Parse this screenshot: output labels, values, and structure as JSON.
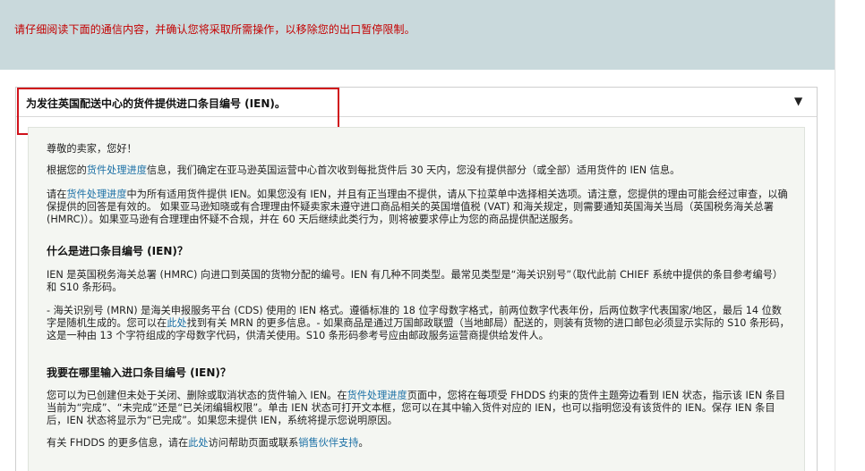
{
  "banner": {
    "text": "请仔细阅读下面的通信内容，并确认您将采取所需操作，以移除您的出口暂停限制。"
  },
  "accordion": {
    "title": "为发往英国配送中心的货件提供进口条目编号 (IEN)。",
    "arrow": "▼"
  },
  "content": {
    "greeting": "尊敬的卖家，您好！",
    "p1_before": "根据您的",
    "p1_link": "货件处理进度",
    "p1_after": "信息，我们确定在亚马逊英国运营中心首次收到每批货件后 30 天内，您没有提供部分（或全部）适用货件的 IEN 信息。",
    "p2_before": "请在",
    "p2_link": "货件处理进度",
    "p2_after": "中为所有适用货件提供 IEN。如果您没有 IEN，并且有正当理由不提供，请从下拉菜单中选择相关选项。请注意，您提供的理由可能会经过审查，以确保提供的回答是有效的。 如果亚马逊知晓或有合理理由怀疑卖家未遵守进口商品相关的英国增值税 (VAT) 和海关规定，则需要通知英国海关当局（英国税务海关总署 (HMRC)）。如果亚马逊有合理理由怀疑不合规，并在 60 天后继续此类行为，则将被要求停止为您的商品提供配送服务。",
    "h1": "什么是进口条目编号 (IEN)？",
    "p3": "IEN 是英国税务海关总署 (HMRC) 向进口到英国的货物分配的编号。IEN 有几种不同类型。最常见类型是“海关识别号”（取代此前 CHIEF 系统中提供的条目参考编号）和 S10 条形码。",
    "p4_before": "- 海关识别号 (MRN) 是海关申报服务平台 (CDS) 使用的 IEN 格式。遵循标准的 18 位字母数字格式，前两位数字代表年份，后两位数字代表国家/地区，最后 14 位数字是随机生成的。您可以在",
    "p4_link": "此处",
    "p4_after": "找到有关 MRN 的更多信息。- 如果商品是通过万国邮政联盟（当地邮局）配送的，则装有货物的进口邮包必须显示实际的 S10 条形码，这是一种由 13 个字符组成的字母数字代码，供清关使用。S10 条形码参考号应由邮政服务运营商提供给发件人。",
    "h2": "我要在哪里输入进口条目编号 (IEN)？",
    "p5_before": "您可以为已创建但未处于关闭、删除或取消状态的货件输入 IEN。在",
    "p5_link": "货件处理进度",
    "p5_after": "页面中，您将在每项受 FHDDS 约束的货件主题旁边看到 IEN 状态，指示该 IEN 条目当前为“完成”、“未完成”还是“已关闭编辑权限”。单击 IEN 状态可打开文本框，您可以在其中输入货件对应的 IEN，也可以指明您没有该货件的 IEN。保存 IEN 条目后，IEN 状态将显示为“已完成”。如果您未提供 IEN，系统将提示您说明原因。",
    "p6_before": "有关 FHDDS 的更多信息，请在",
    "p6_link1": "此处",
    "p6_mid": "访问帮助页面或联系",
    "p6_link2": "销售伙伴支持",
    "p6_after": "。"
  }
}
